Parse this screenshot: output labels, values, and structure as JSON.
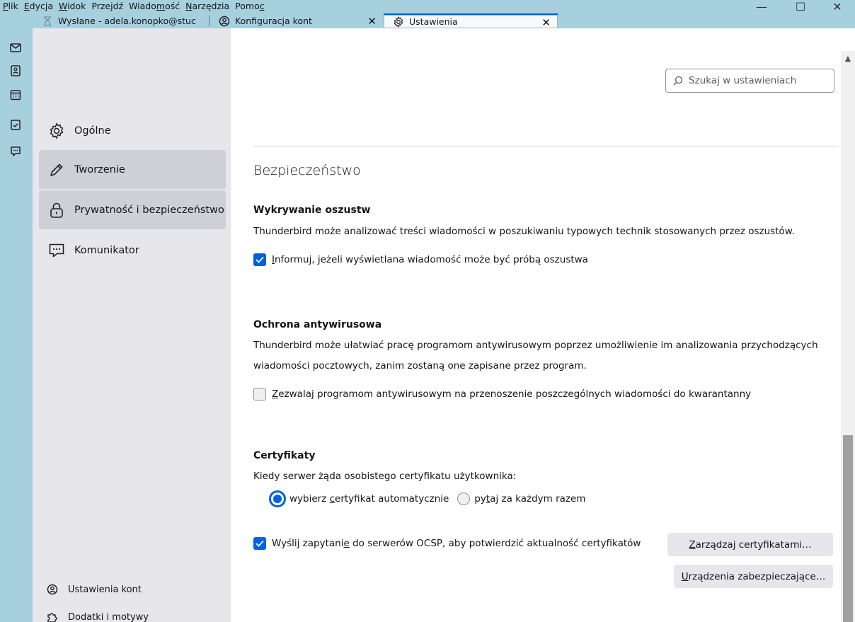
{
  "menu": [
    "Plik",
    "Edycja",
    "Widok",
    "Przejdź",
    "Wiadomość",
    "Narzędzia",
    "Pomoc"
  ],
  "window": {
    "minimize": "—",
    "maximize": "☐",
    "close": "✕"
  },
  "tabs": [
    {
      "label": "Wysłane - adela.konopko@stuc",
      "icon": "hourglass-icon"
    },
    {
      "label": "Konfiguracja kont",
      "icon": "account-icon",
      "close": "✕"
    },
    {
      "label": "Ustawienia",
      "icon": "gear-icon",
      "close": "✕"
    }
  ],
  "spaces": [
    "mail-icon",
    "address-book-icon",
    "calendar-icon",
    "tasks-icon",
    "chat-icon"
  ],
  "sidebar": {
    "items": [
      {
        "label": "Ogólne",
        "icon": "gear-icon"
      },
      {
        "label": "Tworzenie",
        "icon": "pencil-icon"
      },
      {
        "label": "Prywatność i bezpieczeństwo",
        "icon": "lock-icon"
      },
      {
        "label": "Komunikator",
        "icon": "chat-icon"
      }
    ],
    "footer": [
      {
        "label": "Ustawienia kont",
        "icon": "account-icon"
      },
      {
        "label": "Dodatki i motywy",
        "icon": "puzzle-icon"
      }
    ]
  },
  "search": {
    "placeholder": "Szukaj w ustawieniach"
  },
  "section": {
    "title": "Bezpieczeństwo",
    "fraud": {
      "heading": "Wykrywanie oszustw",
      "desc": "Thunderbird może analizować treści wiadomości w poszukiwaniu typowych technik stosowanych przez oszustów.",
      "check_first": "I",
      "check_rest": "nformuj, jeżeli wyświetlana wiadomość może być próbą oszustwa",
      "checked": true
    },
    "antivirus": {
      "heading": "Ochrona antywirusowa",
      "desc1": "Thunderbird może ułatwiać pracę programom antywirusowym poprzez umożliwienie im analizowania przychodzących",
      "desc2": "wiadomości pocztowych, zanim zostaną one zapisane przez program.",
      "check_first": "Z",
      "check_rest": "ezwalaj programom antywirusowym na przenoszenie poszczególnych wiadomości do kwarantanny",
      "checked": false
    },
    "certs": {
      "heading": "Certyfikaty",
      "question": "Kiedy serwer żąda osobistego certyfikatu użytkownika:",
      "radio1_a": "wybierz ",
      "radio1_u": "c",
      "radio1_b": "ertyfikat automatycznie",
      "radio2_a": "py",
      "radio2_u": "t",
      "radio2_b": "aj za każdym razem",
      "selected": "radio1",
      "ocsp_a": "Wyślij zapytani",
      "ocsp_u": "e",
      "ocsp_b": " do serwerów OCSP, aby potwierdzić aktualność certyfikatów",
      "ocsp_checked": true,
      "manage_u": "Z",
      "manage_b": "arządzaj certyfikatami…",
      "devices_u": "U",
      "devices_b": "rządzenia zabezpieczające…"
    }
  },
  "colors": {
    "accent": "#0061e0",
    "chrome": "#a7d0df",
    "sidebar": "#e6e6eb"
  }
}
